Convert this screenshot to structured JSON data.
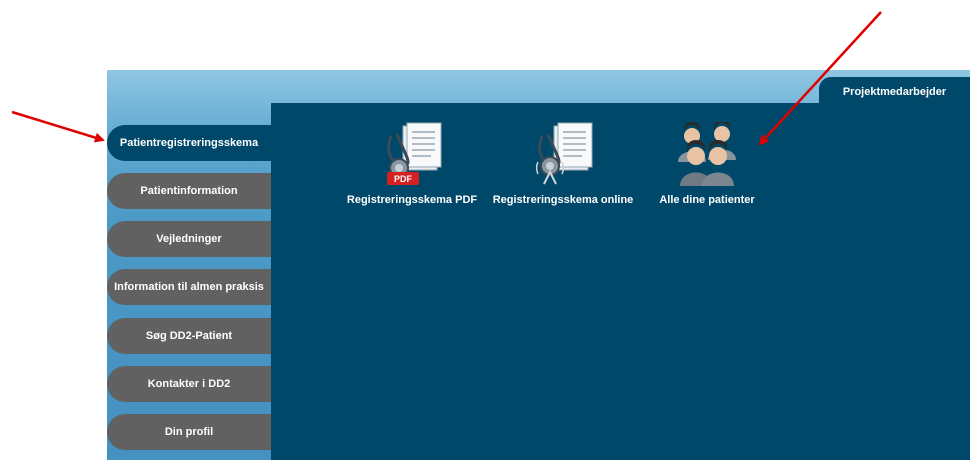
{
  "top_tab": "Projektmedarbejder",
  "nav": [
    {
      "label": "Patientregistreringsskema",
      "active": true
    },
    {
      "label": "Patientinformation",
      "active": false
    },
    {
      "label": "Vejledninger",
      "active": false
    },
    {
      "label": "Information til almen praksis",
      "active": false
    },
    {
      "label": "Søg DD2-Patient",
      "active": false
    },
    {
      "label": "Kontakter i DD2",
      "active": false
    },
    {
      "label": "Din profil",
      "active": false
    }
  ],
  "tiles": [
    {
      "label": "Registreringsskema PDF",
      "icon": "pdf-form-stethoscope-icon",
      "badge": "PDF"
    },
    {
      "label": "Registreringsskema online",
      "icon": "online-form-stethoscope-icon"
    },
    {
      "label": "Alle dine patienter",
      "icon": "patients-group-icon"
    }
  ],
  "colors": {
    "panel": "#00486a",
    "nav_button": "#616161",
    "frame": "#4a99c6",
    "arrow": "#e00000"
  }
}
